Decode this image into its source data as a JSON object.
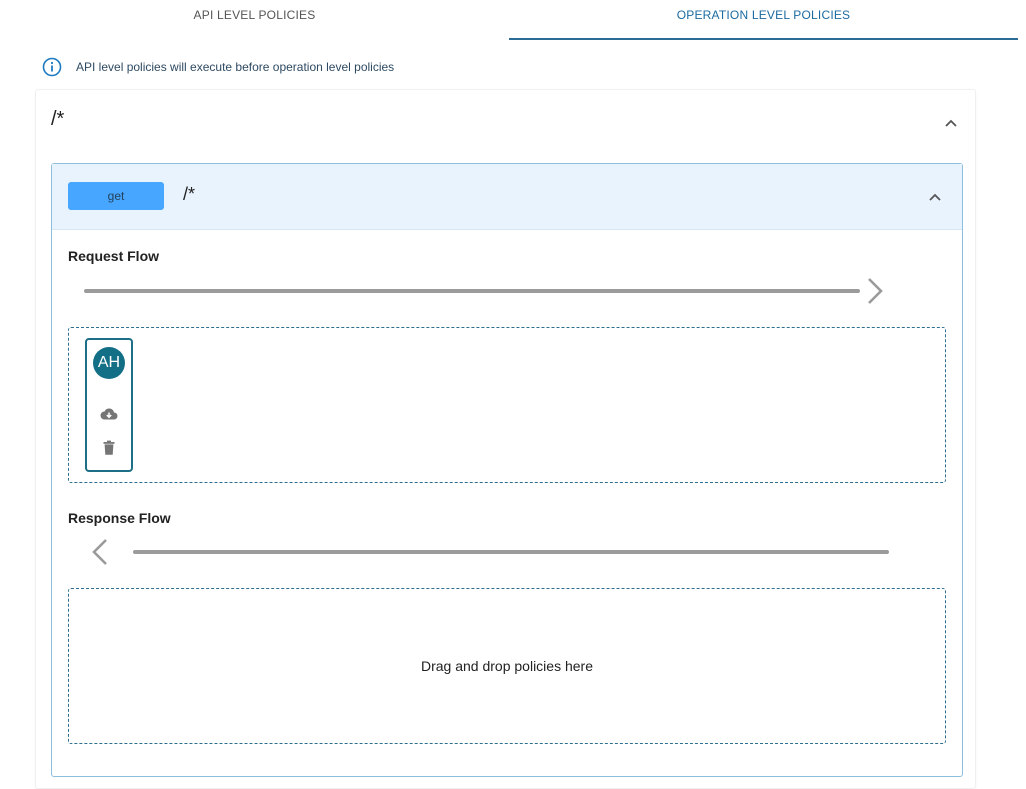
{
  "tabs": [
    {
      "label": "API LEVEL POLICIES",
      "active": false
    },
    {
      "label": "OPERATION LEVEL POLICIES",
      "active": true
    }
  ],
  "info": {
    "text": "API level policies will execute before operation level policies",
    "icon": "info-icon"
  },
  "resource": {
    "path": "/*",
    "operation": {
      "verb": "get",
      "path": "/*",
      "request_flow": {
        "label": "Request Flow",
        "policies": [
          {
            "avatar_text": "AH",
            "actions": [
              "cloud-download-icon",
              "trash-icon"
            ]
          }
        ]
      },
      "response_flow": {
        "label": "Response Flow",
        "placeholder": "Drag and drop policies here"
      }
    }
  },
  "colors": {
    "accent": "#2c6b96",
    "verb_get": "#47a6ff",
    "panel_header": "#e8f3fd",
    "avatar": "#136f86"
  }
}
